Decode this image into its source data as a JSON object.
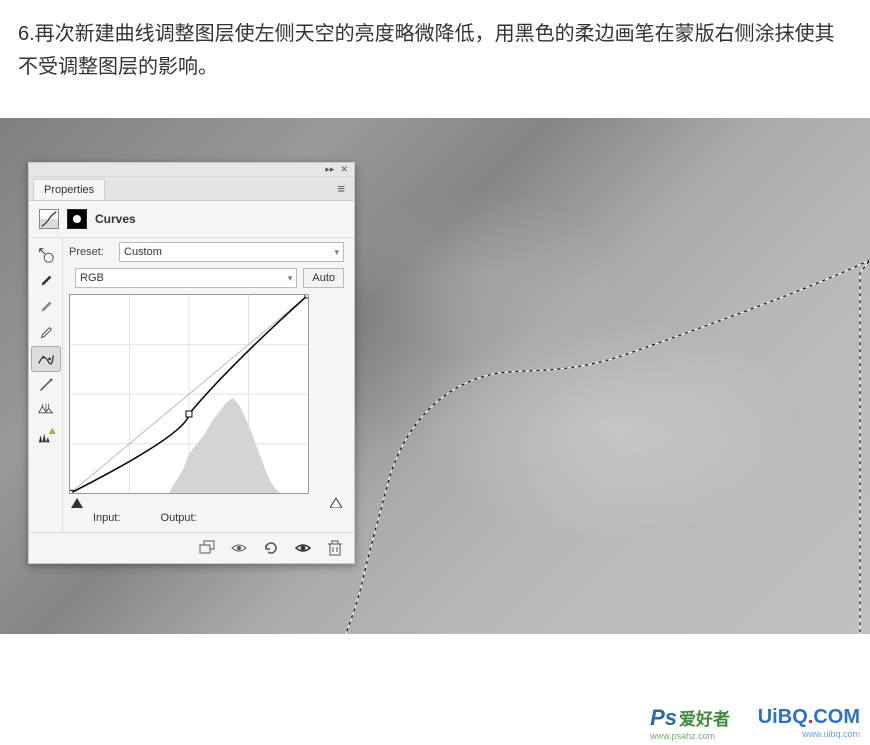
{
  "instruction_text": "6.再次新建曲线调整图层使左侧天空的亮度略微降低，用黑色的柔边画笔在蒙版右侧涂抹使其不受调整图层的影响。",
  "panel": {
    "tab_label": "Properties",
    "adjustment_title": "Curves",
    "preset_label": "Preset:",
    "preset_value": "Custom",
    "channel_value": "RGB",
    "auto_button": "Auto",
    "input_label": "Input:",
    "output_label": "Output:",
    "topbar_collapse": "▸▸",
    "topbar_close": "✕",
    "menu_glyph": "≡"
  },
  "watermark": {
    "site": "UiBO.COM",
    "site_sub": "www.uibq.com",
    "ps_tag": "Ps",
    "ps_text": "爱好者",
    "ps_sub": "www.psahz.com"
  },
  "chart_data": {
    "type": "line",
    "title": "Curves",
    "xlabel": "Input",
    "ylabel": "Output",
    "xlim": [
      0,
      255
    ],
    "ylim": [
      0,
      255
    ],
    "series": [
      {
        "name": "RGB curve",
        "points": [
          {
            "x": 0,
            "y": 0
          },
          {
            "x": 128,
            "y": 102
          },
          {
            "x": 255,
            "y": 255
          }
        ]
      },
      {
        "name": "Baseline",
        "points": [
          {
            "x": 0,
            "y": 0
          },
          {
            "x": 255,
            "y": 255
          }
        ]
      }
    ],
    "histogram_shape": "concentrated between x≈110 and x≈220 with a peak near x≈170"
  }
}
